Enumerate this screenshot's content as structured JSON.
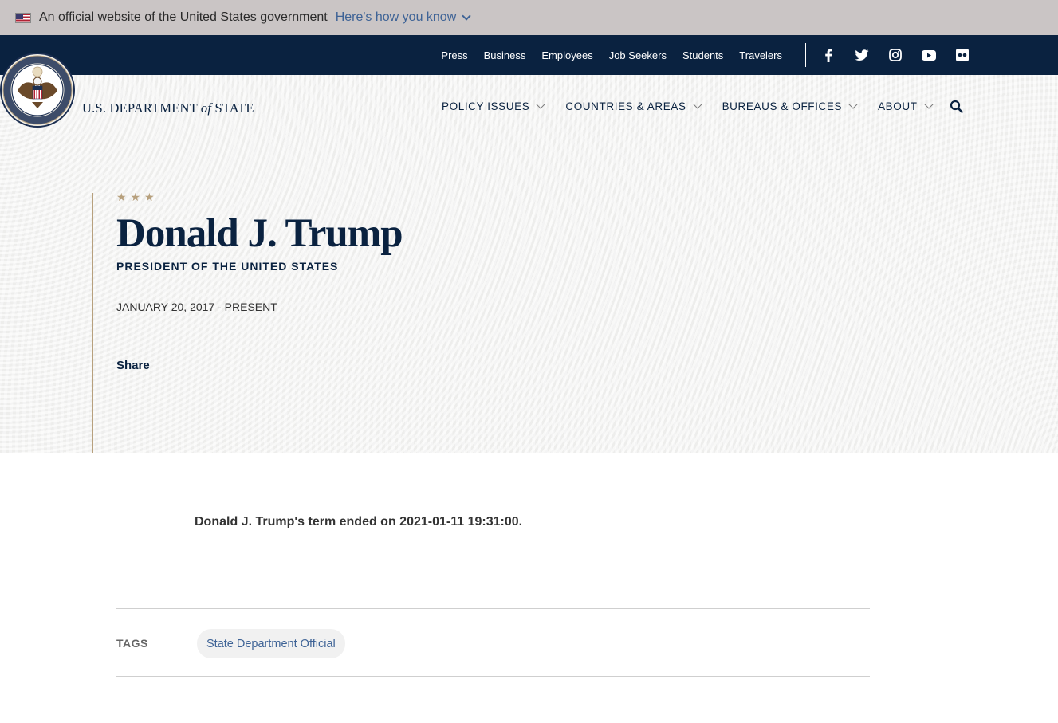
{
  "gov_banner": {
    "text": "An official website of the United States government",
    "link": "Here's how you know"
  },
  "utility_nav": {
    "links": [
      "Press",
      "Business",
      "Employees",
      "Job Seekers",
      "Students",
      "Travelers"
    ],
    "social_icons": [
      "facebook-icon",
      "twitter-icon",
      "instagram-icon",
      "youtube-icon",
      "flickr-icon"
    ]
  },
  "header": {
    "brand_prefix": "U.S. DEPARTMENT ",
    "brand_of": "of",
    "brand_suffix": " STATE",
    "nav": [
      "POLICY ISSUES",
      "COUNTRIES & AREAS",
      "BUREAUS & OFFICES",
      "ABOUT"
    ]
  },
  "hero": {
    "stars": "★★★",
    "name": "Donald J. Trump",
    "title": "PRESIDENT OF THE UNITED STATES",
    "term": "JANUARY 20, 2017 - PRESENT",
    "share": "Share"
  },
  "content": {
    "term_note": "Donald J. Trump's term ended on 2021-01-11 19:31:00.",
    "tags_label": "TAGS",
    "tags": [
      "State Department Official"
    ]
  },
  "colors": {
    "navy": "#0a2240",
    "gold": "#b7a07d",
    "link_blue": "#3e6396"
  }
}
